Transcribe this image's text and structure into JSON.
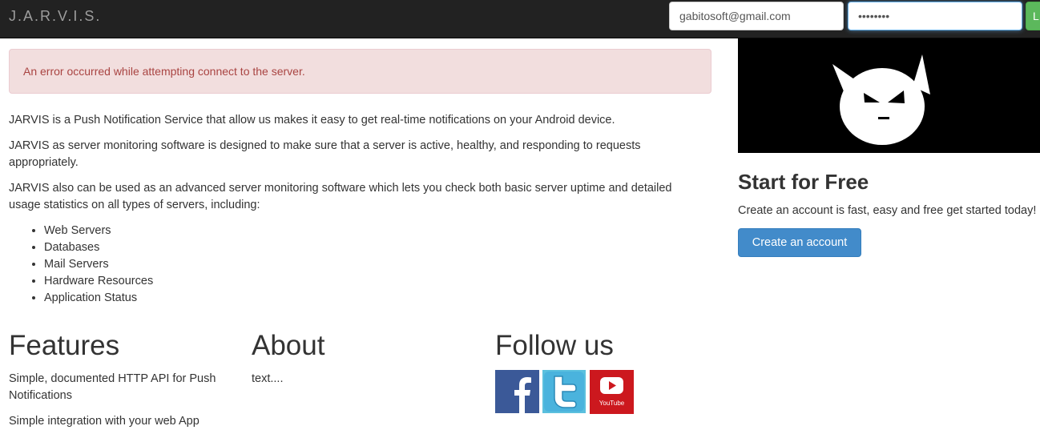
{
  "navbar": {
    "brand": "J.A.R.V.I.S.",
    "email_value": "gabitosoft@gmail.com",
    "password_value": "••••••••",
    "login_label": "L"
  },
  "alert": {
    "text": "An error occurred while attempting connect to the server."
  },
  "intro": {
    "paragraphs": [
      "JARVIS is a Push Notification Service that allow us makes it easy to get real-time notifications on your Android device.",
      "JARVIS as server monitoring software is designed to make sure that a server is active, healthy, and responding to requests appropriately.",
      "JARVIS also can be used as an advanced server monitoring software which lets you check both basic server uptime and detailed usage statistics on all types of servers, including:"
    ],
    "items": [
      "Web Servers",
      "Databases",
      "Mail Servers",
      "Hardware Resources",
      "Application Status"
    ]
  },
  "sidebar": {
    "title": "Start for Free",
    "text": "Create an account is fast, easy and free get started today!",
    "button_label": "Create an account"
  },
  "features": {
    "title": "Features",
    "items": [
      "Simple, documented HTTP API for Push Notifications",
      "Simple integration with your web App"
    ]
  },
  "about": {
    "title": "About",
    "text": "text...."
  },
  "follow": {
    "title": "Follow us",
    "youtube_label": "YouTube",
    "icons": [
      "facebook-icon",
      "twitter-icon",
      "youtube-icon"
    ]
  },
  "colors": {
    "navbar": "#222222",
    "alert_bg": "#f2dede",
    "alert_text": "#a94442",
    "primary": "#428bca",
    "success": "#5cb85c",
    "facebook": "#3b5998",
    "twitter": "#5bc0de",
    "youtube": "#cc181e"
  }
}
